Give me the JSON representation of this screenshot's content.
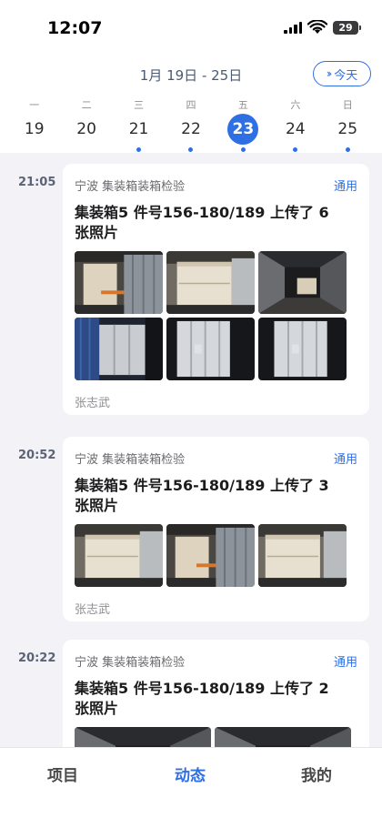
{
  "status_bar": {
    "time": "12:07",
    "battery": "29"
  },
  "calendar": {
    "range": "1月 19日 - 25日",
    "today_label": "今天",
    "days": [
      {
        "weekday": "一",
        "date": "19",
        "has_event": false,
        "selected": false
      },
      {
        "weekday": "二",
        "date": "20",
        "has_event": false,
        "selected": false
      },
      {
        "weekday": "三",
        "date": "21",
        "has_event": true,
        "selected": false
      },
      {
        "weekday": "四",
        "date": "22",
        "has_event": true,
        "selected": false
      },
      {
        "weekday": "五",
        "date": "23",
        "has_event": true,
        "selected": true
      },
      {
        "weekday": "六",
        "date": "24",
        "has_event": true,
        "selected": false
      },
      {
        "weekday": "日",
        "date": "25",
        "has_event": true,
        "selected": false
      }
    ]
  },
  "feed": [
    {
      "time": "21:05",
      "project": "宁波 集装箱装箱检验",
      "tag": "通用",
      "title": "集装箱5 件号156-180/189 上传了 6 张照片",
      "author": "张志武",
      "photos": [
        "container-loading-photo",
        "crate-photo",
        "container-interior-photo",
        "container-door-photo",
        "container-exterior-photo",
        "container-exterior-photo"
      ]
    },
    {
      "time": "20:52",
      "project": "宁波 集装箱装箱检验",
      "tag": "通用",
      "title": "集装箱5 件号156-180/189 上传了 3 张照片",
      "author": "张志武",
      "photos": [
        "crate-photo",
        "container-loading-photo",
        "crate-photo"
      ]
    },
    {
      "time": "20:22",
      "project": "宁波 集装箱装箱检验",
      "tag": "通用",
      "title": "集装箱5 件号156-180/189 上传了 2 张照片",
      "author": "",
      "photos": [
        "container-interior-photo",
        "container-interior-photo"
      ]
    }
  ],
  "tabs": [
    {
      "label": "项目",
      "active": false
    },
    {
      "label": "动态",
      "active": true
    },
    {
      "label": "我的",
      "active": false
    }
  ],
  "colors": {
    "accent": "#2f6fe4",
    "background": "#f2f2f7"
  }
}
